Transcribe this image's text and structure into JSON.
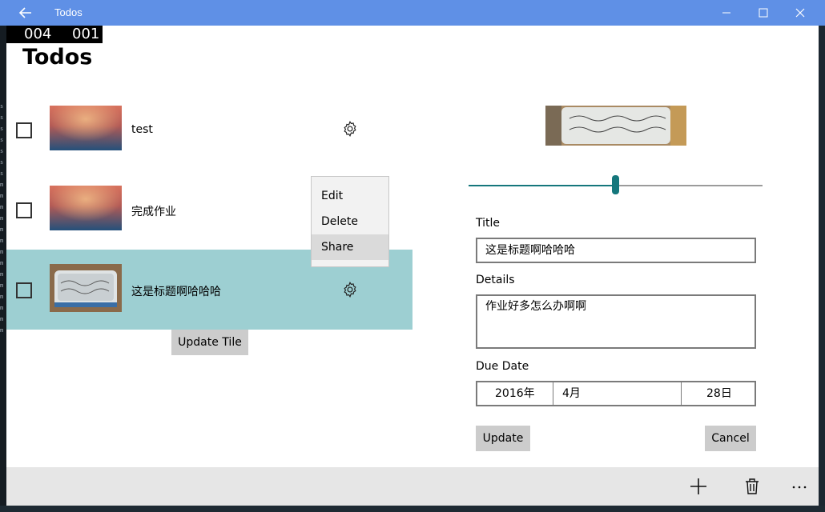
{
  "window": {
    "title": "Todos",
    "accent": "#5f90e6"
  },
  "counter": {
    "left": "004",
    "right": "001"
  },
  "page": {
    "title": "Todos"
  },
  "todos": [
    {
      "label": "test",
      "checked": false,
      "selected": false
    },
    {
      "label": "完成作业",
      "checked": false,
      "selected": false
    },
    {
      "label": "这是标题啊哈哈哈",
      "checked": false,
      "selected": true
    }
  ],
  "context_menu": {
    "items": [
      "Edit",
      "Delete",
      "Share"
    ],
    "hovered": "Share"
  },
  "update_tile_label": "Update Tile",
  "detail": {
    "slider_value_fraction": 0.5,
    "title_label": "Title",
    "title_value": "这是标题啊哈哈哈",
    "details_label": "Details",
    "details_value": "作业好多怎么办啊啊",
    "due_label": "Due Date",
    "due_year": "2016年",
    "due_month": "4月",
    "due_day": "28日",
    "update_label": "Update",
    "cancel_label": "Cancel"
  },
  "appbar": {
    "icons": [
      "add-icon",
      "delete-icon",
      "more-icon"
    ]
  },
  "colors": {
    "selected_row": "#9dcfd2",
    "slider_accent": "#15777c"
  }
}
